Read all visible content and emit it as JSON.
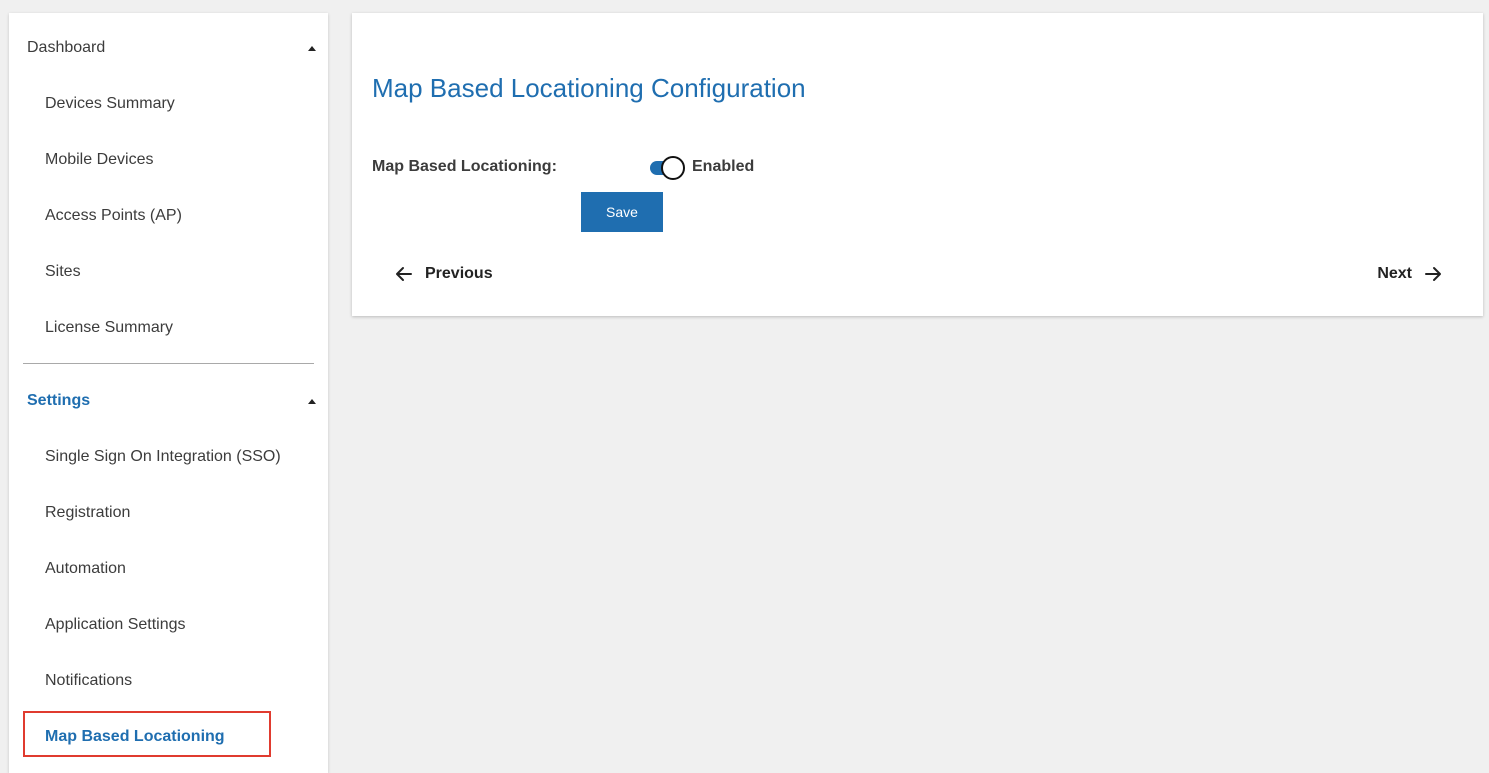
{
  "sidebar": {
    "dashboard": {
      "label": "Dashboard",
      "items": [
        {
          "label": "Devices Summary"
        },
        {
          "label": "Mobile Devices"
        },
        {
          "label": "Access Points (AP)"
        },
        {
          "label": "Sites"
        },
        {
          "label": "License Summary"
        }
      ]
    },
    "settings": {
      "label": "Settings",
      "items": [
        {
          "label": "Single Sign On Integration (SSO)"
        },
        {
          "label": "Registration"
        },
        {
          "label": "Automation"
        },
        {
          "label": "Application Settings"
        },
        {
          "label": "Notifications"
        },
        {
          "label": "Map Based Locationing",
          "active": true
        }
      ]
    }
  },
  "main": {
    "title": "Map Based Locationing Configuration",
    "field_label": "Map Based Locationing:",
    "toggle": {
      "state_label": "Enabled",
      "on": true
    },
    "save_label": "Save",
    "previous_label": "Previous",
    "next_label": "Next"
  },
  "colors": {
    "accent": "#1f6eb0",
    "highlight_border": "#e03b2f",
    "background": "#f0f0f0"
  }
}
